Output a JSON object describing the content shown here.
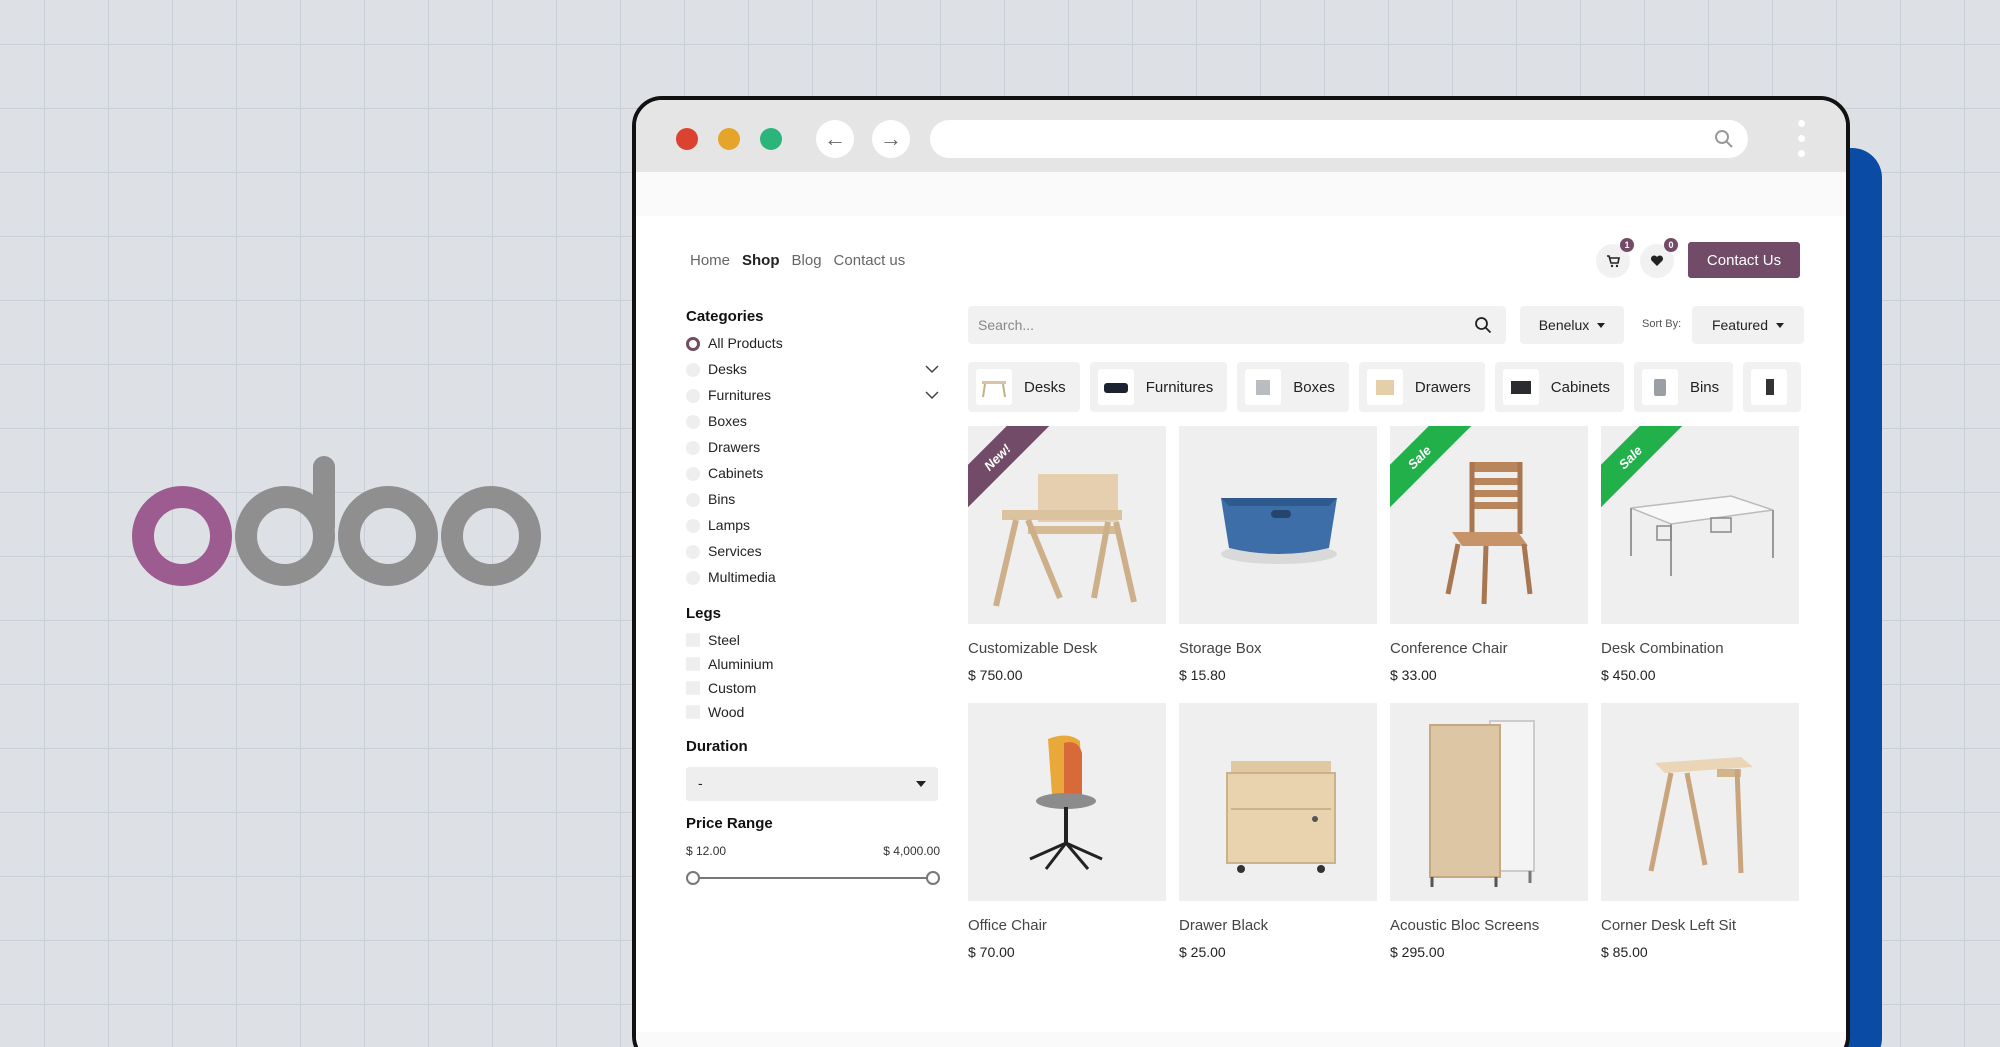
{
  "nav": {
    "items": [
      "Home",
      "Shop",
      "Blog",
      "Contact us"
    ],
    "active": "Shop",
    "cart_count": "1",
    "wishlist_count": "0",
    "contact_button": "Contact Us"
  },
  "sidebar": {
    "categories_heading": "Categories",
    "categories": [
      "All Products",
      "Desks",
      "Furnitures",
      "Boxes",
      "Drawers",
      "Cabinets",
      "Bins",
      "Lamps",
      "Services",
      "Multimedia"
    ],
    "legs_heading": "Legs",
    "legs": [
      "Steel",
      "Aluminium",
      "Custom",
      "Wood"
    ],
    "duration_heading": "Duration",
    "duration_value": "-",
    "price_heading": "Price Range",
    "price_min": "$ 12.00",
    "price_max": "$ 4,000.00"
  },
  "toolbar": {
    "search_placeholder": "Search...",
    "region": "Benelux",
    "sort_label": "Sort By:",
    "sort_value": "Featured"
  },
  "chips": [
    "Desks",
    "Furnitures",
    "Boxes",
    "Drawers",
    "Cabinets",
    "Bins"
  ],
  "products": [
    {
      "name": "Customizable Desk",
      "price": "$ 750.00",
      "ribbon": "New!"
    },
    {
      "name": "Storage Box",
      "price": "$ 15.80",
      "ribbon": ""
    },
    {
      "name": "Conference Chair",
      "price": "$ 33.00",
      "ribbon": "Sale"
    },
    {
      "name": "Desk Combination",
      "price": "$ 450.00",
      "ribbon": "Sale"
    },
    {
      "name": "Office Chair",
      "price": "$ 70.00",
      "ribbon": ""
    },
    {
      "name": "Drawer Black",
      "price": "$ 25.00",
      "ribbon": ""
    },
    {
      "name": "Acoustic Bloc Screens",
      "price": "$ 295.00",
      "ribbon": ""
    },
    {
      "name": "Corner Desk Left Sit",
      "price": "$ 85.00",
      "ribbon": ""
    }
  ],
  "colors": {
    "brand": "#714b67",
    "sale": "#21b04a",
    "shadow_panel": "#0a4ba6"
  }
}
